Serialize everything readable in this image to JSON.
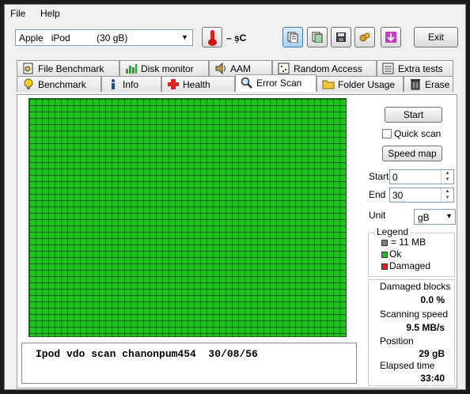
{
  "menu": {
    "file": "File",
    "help": "Help"
  },
  "toolbar": {
    "drive": "Apple   iPod          (30 gB)",
    "temperature": "– ṣC",
    "exit_label": "Exit"
  },
  "tabs_top": [
    {
      "label": "File Benchmark",
      "icon": "file-benchmark-icon"
    },
    {
      "label": "Disk monitor",
      "icon": "disk-monitor-icon"
    },
    {
      "label": "AAM",
      "icon": "speaker-icon"
    },
    {
      "label": "Random Access",
      "icon": "random-access-icon"
    },
    {
      "label": "Extra tests",
      "icon": "extra-tests-icon"
    }
  ],
  "tabs_bottom": [
    {
      "label": "Benchmark",
      "icon": "lightbulb-icon"
    },
    {
      "label": "Info",
      "icon": "info-icon"
    },
    {
      "label": "Health",
      "icon": "health-cross-icon"
    },
    {
      "label": "Error Scan",
      "icon": "magnifier-icon",
      "active": true
    },
    {
      "label": "Folder Usage",
      "icon": "folder-icon"
    },
    {
      "label": "Erase",
      "icon": "trash-icon"
    }
  ],
  "scan": {
    "log_text": "Ipod vdo scan chanonpum454  30/08/56",
    "start_button": "Start",
    "quick_scan_label": "Quick scan",
    "quick_scan_checked": false,
    "speed_map_button": "Speed map",
    "start_label": "Start",
    "start_value": "0",
    "end_label": "End",
    "end_value": "30",
    "unit_label": "Unit",
    "unit_value": "gB"
  },
  "legend": {
    "title": "Legend",
    "block_size": "= 11 MB",
    "ok": "Ok",
    "damaged": "Damaged",
    "colors": {
      "block": "#808080",
      "ok": "#22c022",
      "damaged": "#e02020"
    }
  },
  "stats": {
    "damaged_blocks_label": "Damaged blocks",
    "damaged_blocks_value": "0.0 %",
    "scanning_speed_label": "Scanning speed",
    "scanning_speed_value": "9.5 MB/s",
    "position_label": "Position",
    "position_value": "29 gB",
    "elapsed_label": "Elapsed time",
    "elapsed_value": "33:40"
  }
}
